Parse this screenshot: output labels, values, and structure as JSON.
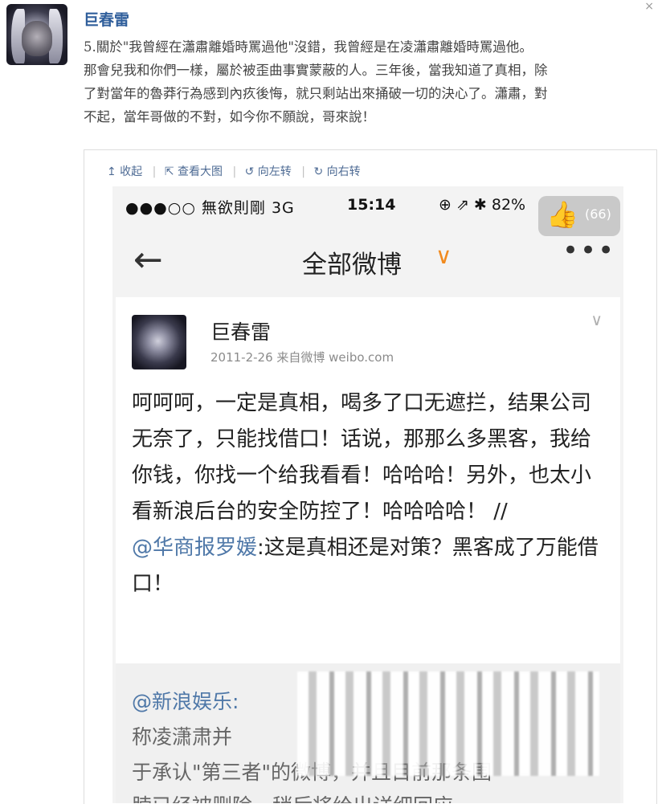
{
  "post": {
    "author": "巨春雷",
    "close": "×",
    "text": "5.關於\"我曾經在瀟肅離婚時罵過他\"沒錯，我曾經是在凌瀟肅離婚時罵過他。\n那會兒我和你們一樣，屬於被歪曲事實蒙蔽的人。三年後，當我知道了真相，除\n了對當年的魯莽行為感到內疚後悔，就只剩站出來捅破一切的決心了。瀟肅，對\n不起，當年哥做的不對，如今你不願說，哥來說！"
  },
  "toolbar": {
    "collapse": "↥ 收起",
    "view_large": "⇱ 查看大图",
    "rotate_left": "↺ 向左转",
    "rotate_right": "↻ 向右转",
    "separator": "|"
  },
  "phone": {
    "status": {
      "signal": "●●●○○ 無欲則剛   3G",
      "time": "15:14",
      "icons": "⊕  ⇗  ✱  82%"
    },
    "like_badge": {
      "icon": "👍",
      "count": "(66)"
    },
    "nav": {
      "back": "←",
      "title": "全部微博",
      "dropdown": "∨",
      "more": "•••"
    },
    "card": {
      "name": "巨春雷",
      "meta": "2011-2-26  来自微博 weibo.com",
      "chevron": "∨",
      "body_main": "呵呵呵，一定是真相，喝多了口无遮拦，结果公司无奈了，只能找借口！话说，那那么多黑客，我给你钱，你找一个给我看看！哈哈哈！另外，也太小看新浪后台的安全防控了！哈哈哈哈！ //",
      "mention": "@华商报罗媛",
      "body_tail": ":这是真相还是对策？黑客成了万能借口！"
    },
    "quote": {
      "line1": "@新浪娱乐:",
      "line2": "称凌潇肃并",
      "line3": "于承认\"第三者\"的微博，并且目前那条围",
      "line4": "脖已经被删除，稍后将给出详细回应。"
    }
  }
}
